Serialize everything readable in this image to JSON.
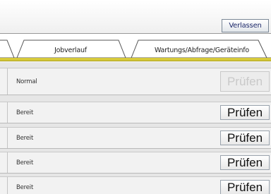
{
  "header": {
    "logout_label": "Verlassen"
  },
  "tabs": [
    {
      "label": "Jobverlauf"
    },
    {
      "label": "Wartungs/Abfrage/Geräteinfo"
    }
  ],
  "rows": [
    {
      "status": "Normal",
      "button_label": "Prüfen",
      "button_enabled": false
    },
    {
      "status": "Bereit",
      "button_label": "Prüfen",
      "button_enabled": true
    },
    {
      "status": "Bereit",
      "button_label": "Prüfen",
      "button_enabled": true
    },
    {
      "status": "Bereit",
      "button_label": "Prüfen",
      "button_enabled": true
    },
    {
      "status": "Bereit",
      "button_label": "Prüfen",
      "button_enabled": true
    }
  ],
  "colors": {
    "accent_line": "#d6c93a",
    "button_text_color": "#1f2a6b"
  }
}
